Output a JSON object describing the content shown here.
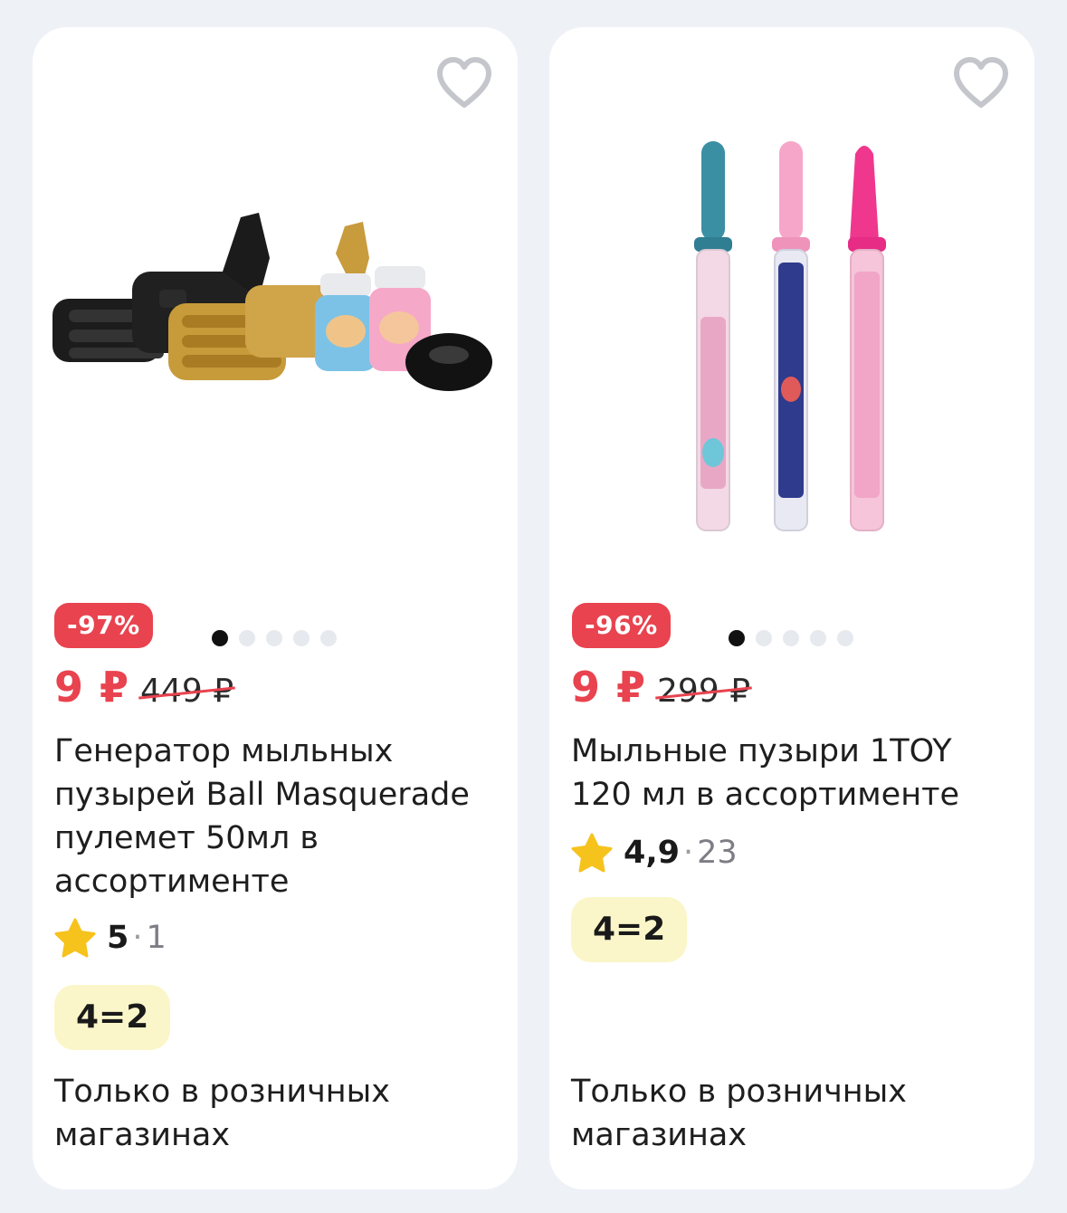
{
  "products": [
    {
      "image": "bubble-gun-set-image",
      "favorite_icon": "heart-outline-icon",
      "discount": "-97%",
      "price": "9 ₽",
      "old_price": "449 ₽",
      "title": "Генератор мыльных пузырей Ball Masquerade пулемет 50мл в ассортименте",
      "rating": {
        "icon": "star-icon",
        "value": "5",
        "separator": "·",
        "count": "1"
      },
      "promo": "4=2",
      "availability": "Только в розничных магазинах",
      "slides_total": 5,
      "slide_active": 1
    },
    {
      "image": "bubble-wands-image",
      "favorite_icon": "heart-outline-icon",
      "discount": "-96%",
      "price": "9 ₽",
      "old_price": "299 ₽",
      "title": "Мыльные пузыри 1TOY 120 мл в ассортименте",
      "rating": {
        "icon": "star-icon",
        "value": "4,9",
        "separator": "·",
        "count": "23"
      },
      "promo": "4=2",
      "availability": "Только в розничных магазинах",
      "slides_total": 5,
      "slide_active": 1
    }
  ],
  "colors": {
    "discount_bg": "#e8434f",
    "price": "#e8434f",
    "promo_bg": "#fbf6c9",
    "star": "#f6c21c",
    "card_bg": "#ffffff",
    "page_bg": "#eef1f6"
  }
}
